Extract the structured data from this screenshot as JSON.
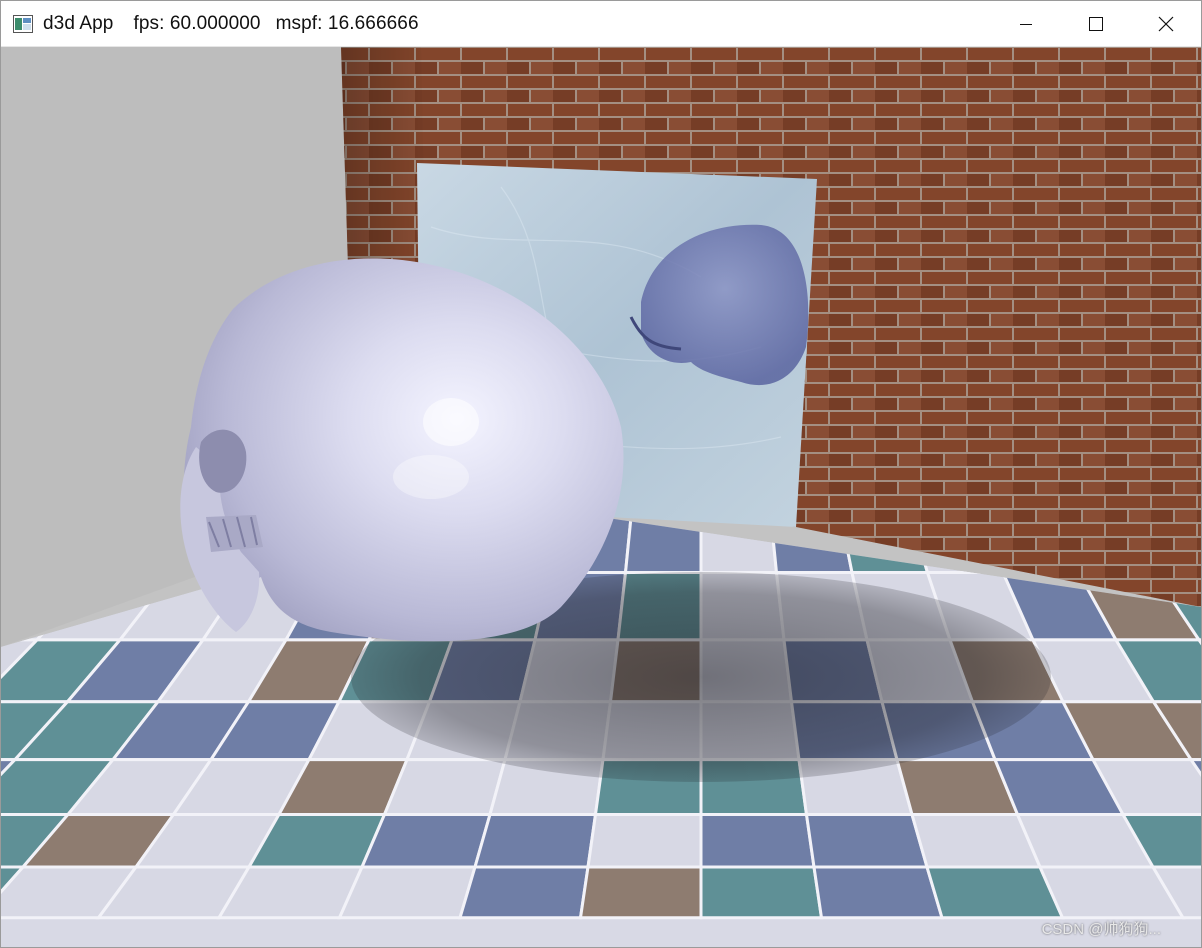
{
  "window": {
    "app_name": "d3d App",
    "fps_text": "fps: 60.000000",
    "mspf_text": "mspf: 16.666666",
    "controls": [
      "minimize-icon",
      "maximize-icon",
      "close-icon"
    ]
  },
  "scene": {
    "description_icon": "d3d-app-icon",
    "colors": {
      "background": "#c3c3c3",
      "brick": "#8a4a2e",
      "mortar": "#b8a89c",
      "mirror": "#b6c8d6",
      "skull": "#d4d4ea",
      "tile_white": "#d7d8e4",
      "tile_blue": "#6f7ea6",
      "tile_teal": "#5f9096",
      "tile_brown": "#8e7c70"
    }
  },
  "watermark": "CSDN @帅狗狗..."
}
